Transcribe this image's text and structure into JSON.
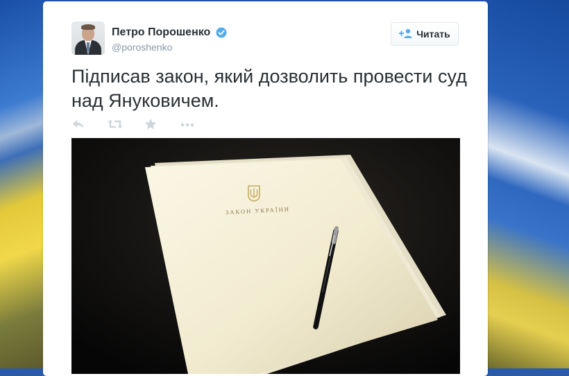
{
  "tweet": {
    "author_name": "Петро Порошенко",
    "author_handle": "@poroshenko",
    "verified": true,
    "text": "Підписав закон, який дозволить провести суд над Януковичем.",
    "follow_label": "Читать",
    "actions": [
      {
        "icon": "reply-icon"
      },
      {
        "icon": "retweet-icon"
      },
      {
        "icon": "favorite-star-icon"
      },
      {
        "icon": "more-dots-icon"
      }
    ],
    "photo": {
      "doc_title": "ЗАКОН УКРАЇНИ"
    }
  },
  "colors": {
    "text": "#292f33",
    "muted": "#8899a6",
    "verified": "#55acee",
    "icon": "#ccd6dd",
    "background_blue": "#2c67c4",
    "background_yellow": "#d8c34a"
  }
}
